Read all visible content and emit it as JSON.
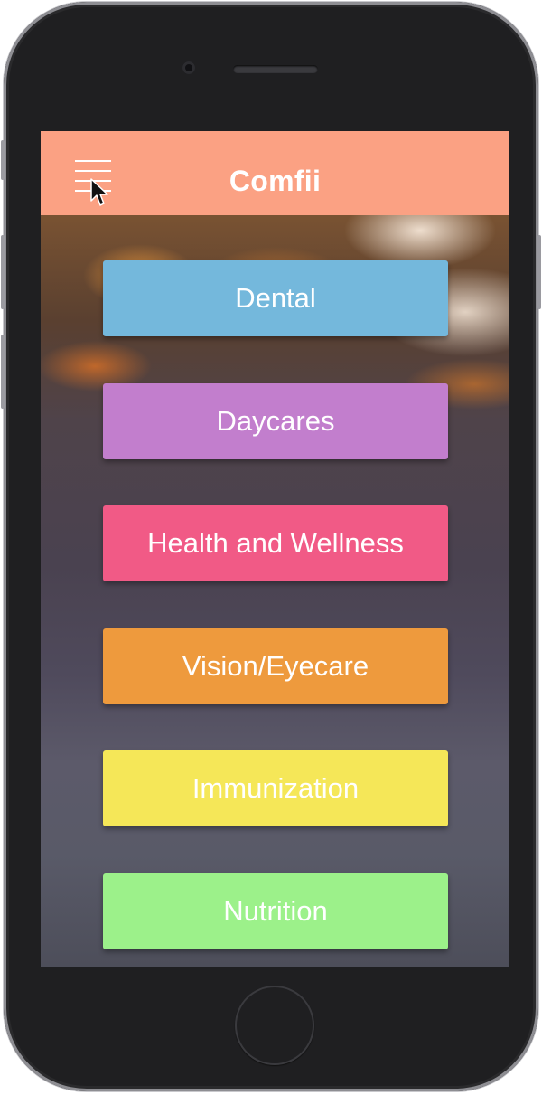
{
  "app": {
    "title": "Comfii"
  },
  "header": {
    "background": "#fba183",
    "menu_icon": "hamburger-icon"
  },
  "categories": [
    {
      "label": "Dental",
      "color": "#74b8dc"
    },
    {
      "label": "Daycares",
      "color": "#c27ecd"
    },
    {
      "label": "Health and Wellness",
      "color": "#f15a86"
    },
    {
      "label": "Vision/Eyecare",
      "color": "#ee9a3d"
    },
    {
      "label": "Immunization",
      "color": "#f5e758"
    },
    {
      "label": "Nutrition",
      "color": "#9cf18a"
    }
  ]
}
